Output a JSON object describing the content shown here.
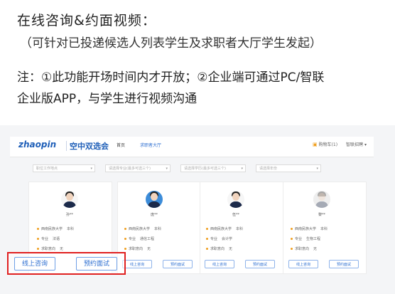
{
  "heading": "在线咨询&约面视频：",
  "subheading": "（可针对已投递候选人列表学生及求职者大厅学生发起）",
  "note_line1": "注：①此功能开场时间内才开放；②企业端可通过PC/智联",
  "note_line2": "企业版APP，与学生进行视频沟通",
  "screenshot": {
    "logo_text": "zhaopin",
    "logo_sub": "空中双选会",
    "nav": [
      "首页",
      "求职者大厅"
    ],
    "cart_label": "购物车(1)",
    "user_label": "智联招聘",
    "filters": [
      "职位工作地点",
      "请选择专业(最多可选三个)",
      "请选择学历(最多可选三个)",
      "请选择年份"
    ],
    "cards": [
      {
        "name": "孙**",
        "school": "西南民族大学",
        "degree": "本科",
        "major_label": "专业",
        "major": "法语",
        "intent_label": "求职意向",
        "intent": "无"
      },
      {
        "name": "庞**",
        "school": "西南民族大学",
        "degree": "本科",
        "major_label": "专业",
        "major": "通信工程",
        "intent_label": "求职意向",
        "intent": "无"
      },
      {
        "name": "伍**",
        "school": "西南民族大学",
        "degree": "本科",
        "major_label": "专业",
        "major": "会计学",
        "intent_label": "求职意向",
        "intent": "无"
      },
      {
        "name": "黎**",
        "school": "西南民族大学",
        "degree": "本科",
        "major_label": "专业",
        "major": "生物工程",
        "intent_label": "求职意向",
        "intent": "无"
      }
    ],
    "btn_consult": "线上咨询",
    "btn_interview": "预约面试",
    "colors": {
      "accent": "#2e6fd1",
      "highlight": "#e02020",
      "bullet": "#f0a020"
    }
  }
}
